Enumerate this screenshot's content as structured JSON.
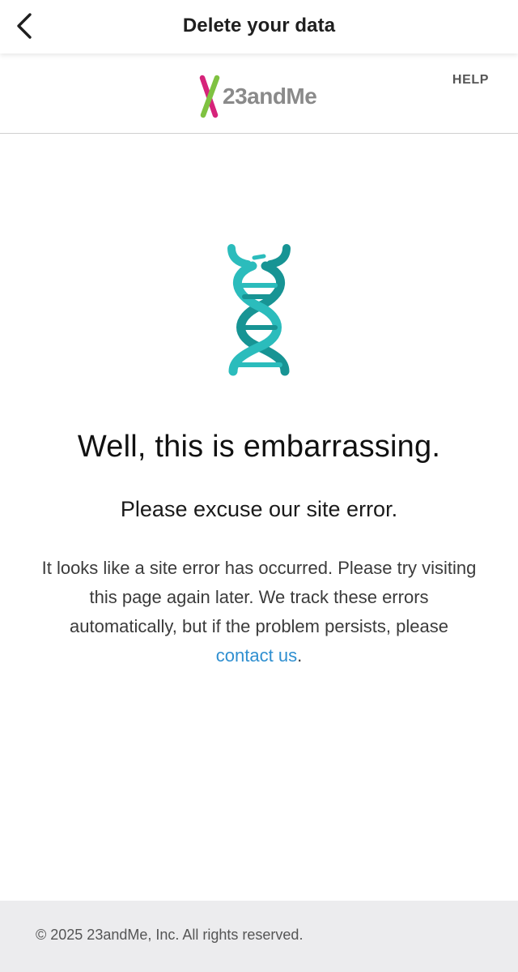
{
  "navbar": {
    "back_icon": "chevron-left-icon",
    "title": "Delete your data"
  },
  "header": {
    "logo_text": "23andMe",
    "help_label": "HELP",
    "logo_colors": {
      "pink": "#d6237a",
      "green": "#7fc241"
    }
  },
  "error": {
    "icon": "dna-helix-icon",
    "icon_colors": {
      "light": "#2bbcbc",
      "dark": "#179494"
    },
    "headline": "Well, this is embarrassing.",
    "subhead": "Please excuse our site error.",
    "body_before_link": "It looks like a site error has occurred. Please try visiting this page again later. We track these errors automatically, but if the problem persists, please ",
    "link_text": "contact us",
    "body_after_link": ".",
    "link_color": "#2f8fd0"
  },
  "footer": {
    "copyright": "© 2025 23andMe, Inc. All rights reserved."
  }
}
